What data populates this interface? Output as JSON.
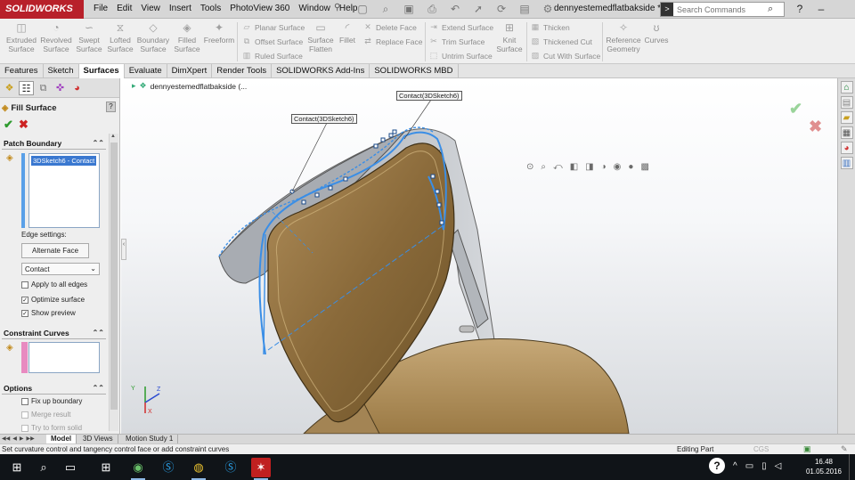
{
  "titlebar": {
    "logo": "SOLIDWORKS",
    "menu": [
      "File",
      "Edit",
      "View",
      "Insert",
      "Tools",
      "PhotoView 360",
      "Window",
      "Help"
    ],
    "document_title": "dennyestemedflatbakside *",
    "search_placeholder": "Search Commands",
    "pin_icon": "pin-icon"
  },
  "commands": {
    "extruded_surface": "Extruded Surface",
    "revolved_surface": "Revolved Surface",
    "swept_surface": "Swept Surface",
    "lofted_surface": "Lofted Surface",
    "boundary_surface": "Boundary Surface",
    "filled_surface": "Filled Surface",
    "freeform": "Freeform",
    "planar_surface": "Planar Surface",
    "offset_surface": "Offset Surface",
    "ruled_surface": "Ruled Surface",
    "surface_flatten": "Surface Flatten",
    "fillet": "Fillet",
    "delete_face": "Delete Face",
    "replace_face": "Replace Face",
    "extend_surface": "Extend Surface",
    "trim_surface": "Trim Surface",
    "untrim_surface": "Untrim Surface",
    "knit_surface": "Knit Surface",
    "thicken": "Thicken",
    "thickened_cut": "Thickened Cut",
    "cut_with_surface": "Cut With Surface",
    "reference_geometry": "Reference Geometry",
    "curves": "Curves"
  },
  "tabs": [
    "Features",
    "Sketch",
    "Surfaces",
    "Evaluate",
    "DimXpert",
    "Render Tools",
    "SOLIDWORKS Add-Ins",
    "SOLIDWORKS MBD"
  ],
  "active_tab": "Surfaces",
  "property_manager": {
    "title": "Fill Surface",
    "help": "?",
    "patch_boundary": {
      "header": "Patch Boundary",
      "selection": "3DSketch6 - Contact",
      "edge_settings_label": "Edge settings:",
      "alternate_face_button": "Alternate Face",
      "edge_type": "Contact",
      "apply_to_all_edges": "Apply to all edges",
      "optimize_surface": "Optimize surface",
      "show_preview": "Show preview"
    },
    "constraint_curves": {
      "header": "Constraint Curves"
    },
    "options": {
      "header": "Options",
      "fix_up_boundary": "Fix up boundary",
      "merge_result": "Merge result",
      "try_to_form_solid": "Try to form solid"
    }
  },
  "viewport": {
    "tree_item": "dennyestemedflatbakside (...",
    "callout_left": "Contact(3DSketch6)",
    "callout_right": "Contact(3DSketch6)"
  },
  "bottom_tabs": [
    "Model",
    "3D Views",
    "Motion Study 1"
  ],
  "active_bottom_tab": "Model",
  "status": {
    "message": "Set curvature control and tangency control face or add constraint curves",
    "mode": "Editing Part",
    "units": "CGS"
  },
  "clock": {
    "time": "16.48",
    "date": "01.05.2016"
  },
  "colors": {
    "brand": "#b8202a",
    "preview_blue": "#3a8ee6",
    "seat_wood": "#8a6a3a"
  }
}
